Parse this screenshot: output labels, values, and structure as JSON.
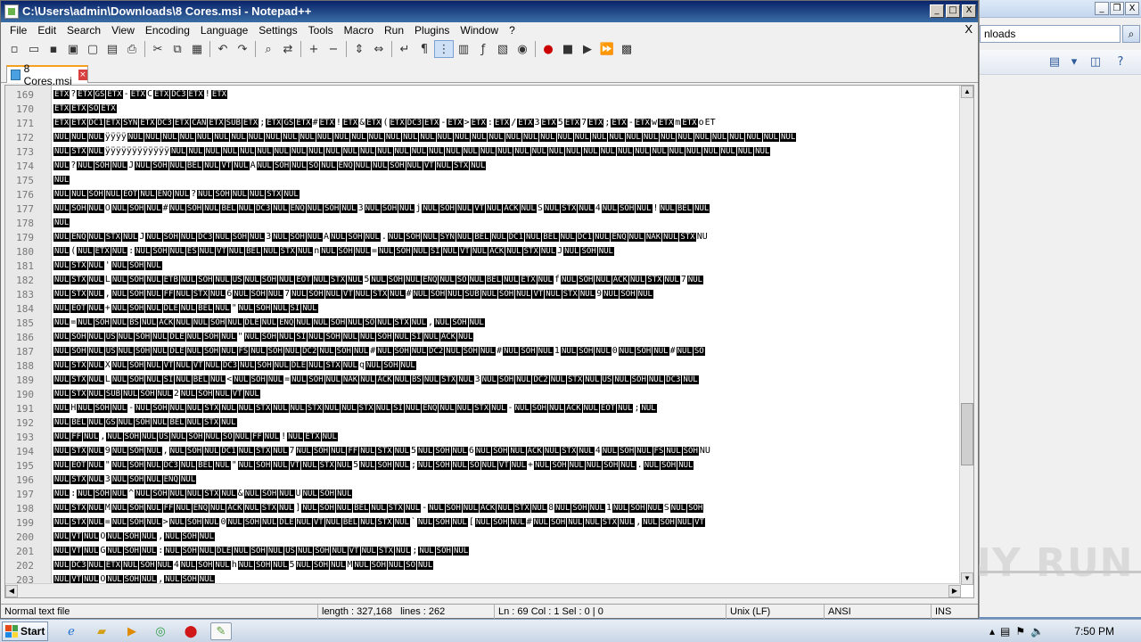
{
  "window": {
    "title": "C:\\Users\\admin\\Downloads\\8 Cores.msi - Notepad++",
    "minimize": "_",
    "maximize": "□",
    "close": "X"
  },
  "menu": {
    "items": [
      "File",
      "Edit",
      "Search",
      "View",
      "Encoding",
      "Language",
      "Settings",
      "Tools",
      "Macro",
      "Run",
      "Plugins",
      "Window",
      "?"
    ],
    "close": "X"
  },
  "toolbar": {
    "icons": [
      "new-file-icon",
      "open-file-icon",
      "save-icon",
      "save-all-icon",
      "close-icon",
      "close-all-icon",
      "print-icon",
      "cut-icon",
      "copy-icon",
      "paste-icon",
      "undo-icon",
      "redo-icon",
      "find-icon",
      "replace-icon",
      "zoom-in-icon",
      "zoom-out-icon",
      "sync-v-icon",
      "sync-h-icon",
      "word-wrap-icon",
      "show-all-chars-icon",
      "indent-guide-icon",
      "doc-map-icon",
      "function-list-icon",
      "folder-workspace-icon",
      "monitoring-icon",
      "record-macro-icon",
      "stop-record-icon",
      "play-macro-icon",
      "run-macro-icon",
      "save-macro-icon"
    ]
  },
  "tab": {
    "label": "8 Cores.msi",
    "close": "×"
  },
  "editor": {
    "lines": [
      {
        "n": "169",
        "t": "ETX ? ETX GS ETX - ETX C ETX DC3 ETX ! ETX"
      },
      {
        "n": "170",
        "t": "ETX ETX SO ETX"
      },
      {
        "n": "171",
        "t": "ETX ETX DC1 ETX SYN ETX DC3 ETX CAN ETX SUB ETX ; ETX GS ETX # ETX ! ETX & ETX ( ETX DC3 ETX - ETX > ETX : ETX / ETX 3 ETX 5 ETX 7 ETX ; ETX - ETX w ETX m ETX o ET"
      },
      {
        "n": "172",
        "t": "NUL NUL NUL ÿÿÿÿ NUL NUL NUL NUL NUL NUL NUL NUL NUL NUL NUL NUL NUL NUL NUL NUL NUL NUL NUL NUL NUL NUL NUL NUL NUL NUL NUL NUL NUL NUL NUL NUL NUL NUL NUL NUL NUL NUL NUL"
      },
      {
        "n": "173",
        "t": "NUL STX NUL ÿÿÿÿÿÿÿÿÿÿÿÿ NUL NUL NUL NUL NUL NUL NUL NUL NUL NUL NUL NUL NUL NUL NUL NUL NUL NUL NUL NUL NUL NUL NUL NUL NUL NUL NUL NUL NUL NUL NUL NUL NUL NUL NUL"
      },
      {
        "n": "174",
        "t": "NUL ? NUL SOH NUL J NUL SOH NUL BEL NUL VT NUL A NUL SOH NUL SO NUL ENQ NUL NUL SOH NUL VT NUL STX NUL"
      },
      {
        "n": "175",
        "t": "NUL"
      },
      {
        "n": "176",
        "t": "NUL NUL SOH NUL EOT NUL ENQ NUL ? NUL SOH NUL NUL STX NUL"
      },
      {
        "n": "177",
        "t": "NUL SOH NUL O NUL SOH NUL # NUL SOH NUL BEL NUL DC3 NUL ENQ NUL SOH NUL 3 NUL SOH NUL j NUL SOH NUL VT NUL ACK NUL S NUL STX NUL 4 NUL SOH NUL ! NUL BEL NUL"
      },
      {
        "n": "178",
        "t": "NUL"
      },
      {
        "n": "179",
        "t": "NUL ENQ NUL STX NUL J NUL SOH NUL DC3 NUL SOH NUL 3 NUL SOH NUL A NUL SOH NUL . NUL SOH NUL SYN NUL BEL NUL DC1 NUL BEL NUL DC1 NUL ENQ NUL NAK NUL STX NU"
      },
      {
        "n": "180",
        "t": "NUL ( NUL ETX NUL : NUL SOH NUL ES NUL VT NUL BEL NUL STX NUL n NUL SOH NUL = NUL SOH NUL SI NUL VT NUL ACK NUL STX NUL J NUL SOH NUL"
      },
      {
        "n": "181",
        "t": "NUL STX NUL ' NUL SOH NUL"
      },
      {
        "n": "182",
        "t": "NUL STX NUL L NUL SOH NUL ETB NUL SOH NUL US NUL SOH NUL EOT NUL STX NUL 5 NUL SOH NUL ENQ NUL SO NUL BEL NUL ETX NUL f NUL SOH NUL ACK NUL STX NUL 7 NUL"
      },
      {
        "n": "183",
        "t": "NUL STX NUL , NUL SOH NUL FF NUL STX NUL 6 NUL SOH NUL 7 NUL SOH NUL VT NUL STX NUL # NUL SOH NUL SUB NUL SOH NUL VT NUL STX NUL 9 NUL SOH NUL"
      },
      {
        "n": "184",
        "t": "NUL EOT NUL + NUL SOH NUL DLE NUL BEL NUL \" NUL SOH NUL SI NUL"
      },
      {
        "n": "185",
        "t": "NUL = NUL SOH NUL BS NUL ACK NUL NUL SOH NUL DLE NUL ENQ NUL NUL SOH NUL SO NUL STX NUL , NUL SOH NUL"
      },
      {
        "n": "186",
        "t": "NUL SOH NUL US NUL SOH NUL DLE NUL SOH NUL \" NUL SOH NUL SI NUL SOH NUL NUL SOH NUL SI NUL ACK NUL"
      },
      {
        "n": "187",
        "t": "NUL SOH NUL US NUL SOH NUL DLE NUL SOH NUL FS NUL SOH NUL DC2 NUL SOH NUL # NUL SOH NUL DC2 NUL SOH NUL # NUL SOH NUL 1 NUL SOH NUL 0 NUL SOH NUL # NUL SO"
      },
      {
        "n": "188",
        "t": "NUL STX NUL X NUL SOH NUL VT NUL VT NUL DC3 NUL SOH NUL DLE NUL STX NUL q NUL SOH NUL"
      },
      {
        "n": "189",
        "t": "NUL STX NUL L NUL SOH NUL SI NUL BEL NUL < NUL SOH NUL = NUL SOH NUL NAK NUL ACK NUL BS NUL STX NUL 3 NUL SOH NUL DC2 NUL STX NUL US NUL SOH NUL DC3 NUL"
      },
      {
        "n": "190",
        "t": "NUL STX NUL SUB NUL SOH NUL 2 NUL SOH NUL VT NUL"
      },
      {
        "n": "191",
        "t": "NUL H NUL SOH NUL - NUL SOH NUL NUL STX NUL NUL STX NUL NUL STX NUL NUL STX NUL SI NUL ENQ NUL NUL STX NUL - NUL SOH NUL ACK NUL EOT NUL ; NUL"
      },
      {
        "n": "192",
        "t": "NUL BEL NUL GS NUL SOH NUL BEL NUL STX NUL"
      },
      {
        "n": "193",
        "t": "NUL FF NUL , NUL SOH NUL US NUL SOH NUL SO NUL FF NUL ! NUL ETX NUL"
      },
      {
        "n": "194",
        "t": "NUL STX NUL 9 NUL SOH NUL , NUL SOH NUL DC1 NUL STX NUL 7 NUL SOH NUL FF NUL STX NUL 5 NUL SOH NUL 6 NUL SOH NUL ACK NUL STX NUL 4 NUL SOH NUL FS NUL SOH NU"
      },
      {
        "n": "195",
        "t": "NUL EOT NUL \" NUL SOH NUL DC3 NUL BEL NUL \" NUL SOH NUL VT NUL STX NUL 5 NUL SOH NUL ; NUL SOH NUL SO NUL VT NUL + NUL SOH NUL NUL SOH NUL . NUL SOH NUL"
      },
      {
        "n": "196",
        "t": "NUL STX NUL 3 NUL SOH NUL ENQ NUL"
      },
      {
        "n": "197",
        "t": "NUL : NUL SOH NUL ^ NUL SOH NUL NUL STX NUL & NUL SOH NUL U NUL SOH NUL"
      },
      {
        "n": "198",
        "t": "NUL STX NUL M NUL SOH NUL FF NUL ENQ NUL ACK NUL STX NUL ] NUL SOH NUL BEL NUL STX NUL - NUL SOH NUL ACK NUL STX NUL 8 NUL SOH NUL 1 NUL SOH NUL Š NUL SOH"
      },
      {
        "n": "199",
        "t": "NUL STX NUL = NUL SOH NUL > NUL SOH NUL 0 NUL SOH NUL DLE NUL VT NUL BEL NUL STX NUL ` NUL SOH NUL [ NUL SOH NUL # NUL SOH NUL NUL STX NUL , NUL SOH NUL VT"
      },
      {
        "n": "200",
        "t": "NUL VT NUL Ó NUL SOH NUL , NUL SOH NUL"
      },
      {
        "n": "201",
        "t": "NUL VT NUL G NUL SOH NUL : NUL SOH NUL DLE NUL SOH NUL US NUL SOH NUL VT NUL STX NUL ; NUL SOH NUL"
      },
      {
        "n": "202",
        "t": "NUL DC3 NUL ETX NUL SOH NUL 4 NUL SOH NUL h NUL SOH NUL 5 NUL SOH NUL M NUL SOH NUL SO NUL"
      },
      {
        "n": "203",
        "t": "NUL VT NUL Ó NUL SOH NUL , NUL SOH NUL"
      }
    ]
  },
  "status": {
    "type": "Normal text file",
    "length": "length : 327,168",
    "lines": "lines : 262",
    "pos": "Ln : 69    Col : 1    Sel : 0 | 0",
    "eol": "Unix (LF)",
    "encoding": "ANSI",
    "mode": "INS"
  },
  "explorer": {
    "address": "nloads",
    "minimize": "_",
    "restore": "❐",
    "close": "X"
  },
  "taskbar": {
    "start": "Start",
    "clock": "7:50 PM"
  },
  "watermark": "ANY RUN"
}
